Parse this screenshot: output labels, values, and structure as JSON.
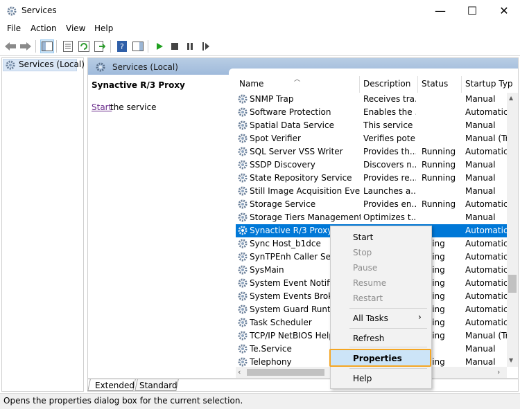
{
  "window": {
    "title": "Services",
    "controls": {
      "minimize": "—",
      "maximize": "☐",
      "close": "✕"
    }
  },
  "menu": [
    "File",
    "Action",
    "View",
    "Help"
  ],
  "tree": {
    "item": "Services (Local)"
  },
  "pane": {
    "header": "Services (Local)",
    "service_title": "Synactive R/3 Proxy",
    "start_link": "Start",
    "start_rest": "the service"
  },
  "columns": {
    "name": "Name",
    "description": "Description",
    "status": "Status",
    "startup": "Startup Typ"
  },
  "rows": [
    {
      "name": "SNMP Trap",
      "desc": "Receives tra...",
      "status": "",
      "startup": "Manual"
    },
    {
      "name": "Software Protection",
      "desc": "Enables the ...",
      "status": "",
      "startup": "Automatic"
    },
    {
      "name": "Spatial Data Service",
      "desc": "This service ...",
      "status": "",
      "startup": "Manual"
    },
    {
      "name": "Spot Verifier",
      "desc": "Verifies pote...",
      "status": "",
      "startup": "Manual (Tri"
    },
    {
      "name": "SQL Server VSS Writer",
      "desc": "Provides th...",
      "status": "Running",
      "startup": "Automatic"
    },
    {
      "name": "SSDP Discovery",
      "desc": "Discovers n...",
      "status": "Running",
      "startup": "Manual"
    },
    {
      "name": "State Repository Service",
      "desc": "Provides re...",
      "status": "Running",
      "startup": "Manual"
    },
    {
      "name": "Still Image Acquisition Events",
      "desc": "Launches a...",
      "status": "",
      "startup": "Manual"
    },
    {
      "name": "Storage Service",
      "desc": "Provides en...",
      "status": "Running",
      "startup": "Automatic"
    },
    {
      "name": "Storage Tiers Management",
      "desc": "Optimizes t...",
      "status": "",
      "startup": "Manual"
    },
    {
      "name": "Synactive R/3 Proxy",
      "desc": "",
      "status": "",
      "startup": "Automatic"
    },
    {
      "name": "Sync Host_b1dce",
      "desc": "",
      "status": "nning",
      "startup": "Automatic"
    },
    {
      "name": "SynTPEnh Caller Servi",
      "desc": "",
      "status": "nning",
      "startup": "Automatic"
    },
    {
      "name": "SysMain",
      "desc": "",
      "status": "nning",
      "startup": "Automatic"
    },
    {
      "name": "System Event Notifica",
      "desc": "",
      "status": "nning",
      "startup": "Automatic"
    },
    {
      "name": "System Events Broker",
      "desc": "",
      "status": "nning",
      "startup": "Automatic"
    },
    {
      "name": "System Guard Runtim",
      "desc": "",
      "status": "nning",
      "startup": "Automatic"
    },
    {
      "name": "Task Scheduler",
      "desc": "",
      "status": "nning",
      "startup": "Automatic"
    },
    {
      "name": "TCP/IP NetBIOS Helpe",
      "desc": "",
      "status": "nning",
      "startup": "Manual (Tri"
    },
    {
      "name": "Te.Service",
      "desc": "",
      "status": "",
      "startup": "Manual"
    },
    {
      "name": "Telephony",
      "desc": "",
      "status": "nning",
      "startup": "Manual"
    }
  ],
  "selected_row": "Synactive R/3 Proxy",
  "context_menu": {
    "start": "Start",
    "stop": "Stop",
    "pause": "Pause",
    "resume": "Resume",
    "restart": "Restart",
    "all_tasks": "All Tasks",
    "refresh": "Refresh",
    "properties": "Properties",
    "help": "Help"
  },
  "tabs": [
    "Extended",
    "Standard"
  ],
  "status_bar": "Opens the properties dialog box for the current selection.",
  "colors": {
    "selection": "#0078d7",
    "highlight_border": "#f5a623",
    "header_band": "#a9c2df"
  }
}
